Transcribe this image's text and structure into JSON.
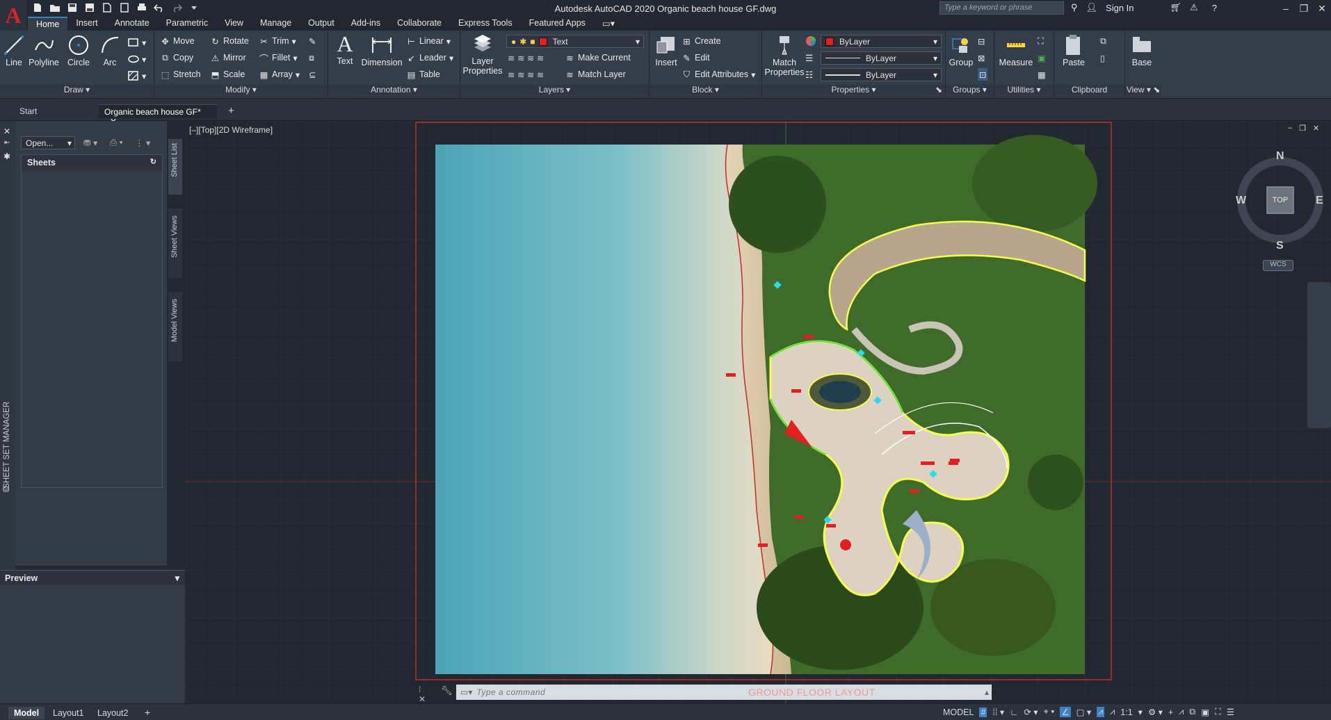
{
  "app": {
    "window_title": "Autodesk AutoCAD 2020   Organic beach house GF.dwg",
    "search_placeholder": "Type a keyword or phrase",
    "sign_in": "Sign In",
    "logo_letter": "A"
  },
  "ribbon_tabs": [
    "Home",
    "Insert",
    "Annotate",
    "Parametric",
    "View",
    "Manage",
    "Output",
    "Add-ins",
    "Collaborate",
    "Express Tools",
    "Featured Apps"
  ],
  "ribbon": {
    "draw": {
      "title": "Draw",
      "line": "Line",
      "polyline": "Polyline",
      "circle": "Circle",
      "arc": "Arc"
    },
    "modify": {
      "title": "Modify",
      "move": "Move",
      "rotate": "Rotate",
      "trim": "Trim",
      "copy": "Copy",
      "mirror": "Mirror",
      "fillet": "Fillet",
      "stretch": "Stretch",
      "scale": "Scale",
      "array": "Array"
    },
    "annotation": {
      "title": "Annotation",
      "text": "Text",
      "dimension": "Dimension",
      "linear": "Linear",
      "leader": "Leader",
      "table": "Table"
    },
    "layers": {
      "title": "Layers",
      "layer_properties": "Layer\nProperties",
      "current_layer": "Text",
      "make_current": "Make Current",
      "match_layer": "Match Layer"
    },
    "block": {
      "title": "Block",
      "insert": "Insert",
      "create": "Create",
      "edit": "Edit",
      "edit_attributes": "Edit Attributes"
    },
    "properties": {
      "title": "Properties",
      "match_properties": "Match\nProperties",
      "color": "ByLayer",
      "linetype": "ByLayer",
      "lineweight": "ByLayer"
    },
    "groups": {
      "title": "Groups",
      "group": "Group"
    },
    "utilities": {
      "title": "Utilities",
      "measure": "Measure"
    },
    "clipboard": {
      "title": "Clipboard",
      "paste": "Paste"
    },
    "view": {
      "title": "View",
      "base": "Base"
    }
  },
  "doc_tabs": {
    "start": "Start",
    "active": "Organic beach house GF*"
  },
  "sheet_set_manager": {
    "label": "SHEET SET MANAGER",
    "open_dropdown": "Open...",
    "sheets_header": "Sheets",
    "tab_sheet_list": "Sheet List",
    "tab_sheet_views": "Sheet Views",
    "tab_model_views": "Model Views",
    "preview": "Preview"
  },
  "viewport": {
    "label": "[–][Top][2D Wireframe]"
  },
  "viewcube": {
    "n": "N",
    "s": "S",
    "e": "E",
    "w": "W",
    "face": "TOP",
    "ucs": "WCS"
  },
  "command_line": {
    "placeholder": "Type a command",
    "drawing_title": "GROUND FLOOR LAYOUT"
  },
  "layout_tabs": [
    "Model",
    "Layout1",
    "Layout2"
  ],
  "status_bar": {
    "space": "MODEL",
    "scale": "1:1"
  },
  "colors": {
    "accent": "#3c82c7",
    "layer_red": "#e32020",
    "plan_border": "#c22b2b"
  }
}
